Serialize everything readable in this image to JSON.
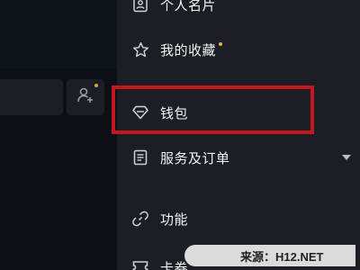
{
  "menu": {
    "items": [
      {
        "label": "个人名片",
        "icon": "id-card-icon"
      },
      {
        "label": "我的收藏",
        "icon": "star-icon",
        "has_dot": true
      },
      {
        "label": "钱包",
        "icon": "diamond-icon"
      },
      {
        "label": "服务及订单",
        "icon": "document-icon",
        "expandable": true
      },
      {
        "label": "功能",
        "icon": "link-icon"
      },
      {
        "label": "卡券",
        "icon": "ticket-icon"
      }
    ]
  },
  "left_panel": {
    "add_friend_icon": "add-user-icon"
  },
  "highlight_color": "#c8161d",
  "dot_color": "#e2b13c",
  "watermark": {
    "text": "来源：H12.NET"
  }
}
